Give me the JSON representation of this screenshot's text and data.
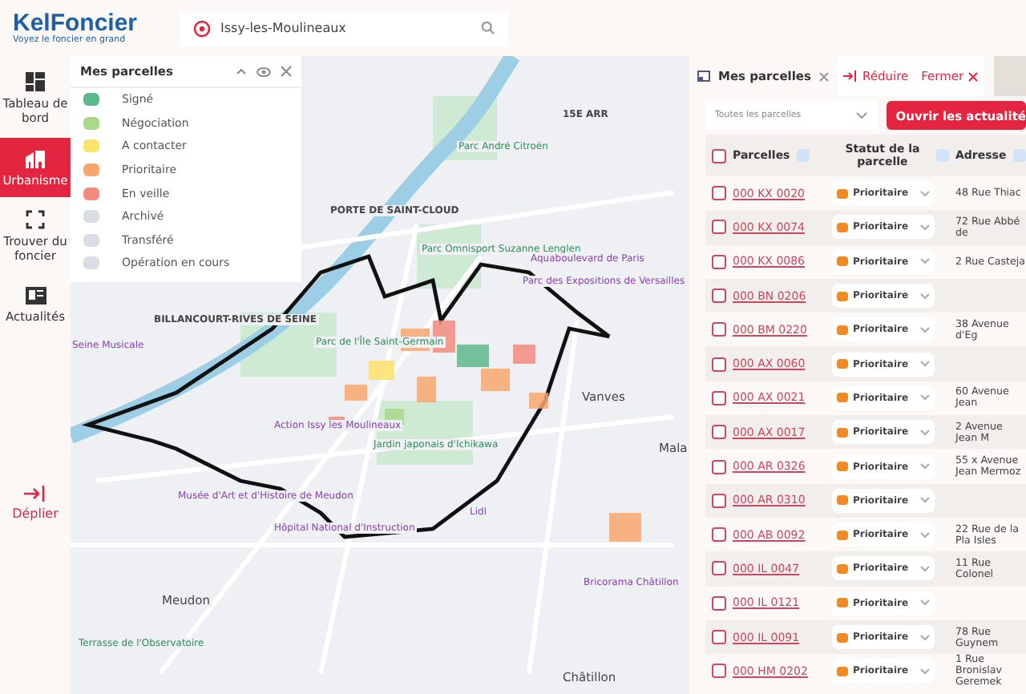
{
  "header": {
    "logo": "KelFoncier",
    "tagline": "Voyez le foncier en grand",
    "search": {
      "value": "Issy-les-Moulineaux"
    }
  },
  "sidebar": {
    "items": [
      {
        "label": "Tableau de bord",
        "selected": false
      },
      {
        "label": "Urbanisme",
        "selected": true
      },
      {
        "label": "Trouver du foncier",
        "selected": false
      },
      {
        "label": "Actualités",
        "selected": false
      }
    ],
    "expand": "Déplier"
  },
  "legend": {
    "title": "Mes parcelles",
    "items": [
      {
        "label": "Signé",
        "color": "#5cb98a"
      },
      {
        "label": "Négociation",
        "color": "#a8d98a"
      },
      {
        "label": "A contacter",
        "color": "#fde26a"
      },
      {
        "label": "Prioritaire",
        "color": "#f9a66c"
      },
      {
        "label": "En veille",
        "color": "#f28b7e"
      },
      {
        "label": "Archivé",
        "color": "#d9dde6"
      },
      {
        "label": "Transféré",
        "color": "#d9dde6"
      },
      {
        "label": "Opération en cours",
        "color": "#d9dde6"
      }
    ]
  },
  "map": {
    "labels": [
      {
        "text": "15E ARR",
        "kind": "district"
      },
      {
        "text": "Parc André Citroën",
        "kind": "park"
      },
      {
        "text": "PORTE DE SAINT-CLOUD",
        "kind": "district"
      },
      {
        "text": "Parc Omnisport Suzanne Lenglen",
        "kind": "park"
      },
      {
        "text": "Aquaboulevard de Paris",
        "kind": "poi"
      },
      {
        "text": "Parc des Expositions de Versailles",
        "kind": "poi"
      },
      {
        "text": "BILLANCOURT-RIVES DE SEINE",
        "kind": "district"
      },
      {
        "text": "Seine Musicale",
        "kind": "poi"
      },
      {
        "text": "Parc de l'Île Saint-Germain",
        "kind": "park"
      },
      {
        "text": "Action Issy les Moulineaux",
        "kind": "poi"
      },
      {
        "text": "Jardin japonais d'Ichikawa",
        "kind": "park"
      },
      {
        "text": "Vanves",
        "kind": "town"
      },
      {
        "text": "Musée d'Art et d'Histoire de Meudon",
        "kind": "poi"
      },
      {
        "text": "Hôpital National d'Instruction",
        "kind": "poi"
      },
      {
        "text": "Lidl",
        "kind": "poi"
      },
      {
        "text": "Meudon",
        "kind": "town"
      },
      {
        "text": "Mala",
        "kind": "town"
      },
      {
        "text": "Bricorama Châtillon",
        "kind": "poi"
      },
      {
        "text": "Terrasse de l'Observatoire",
        "kind": "park"
      },
      {
        "text": "Châtillon",
        "kind": "town"
      }
    ]
  },
  "panel": {
    "tab": {
      "label": "Mes parcelles",
      "selected": true
    },
    "reduce": "Réduire",
    "close": "Fermer",
    "filter": {
      "value": "Toutes les parcelles"
    },
    "news_button": "Ouvrir les actualité",
    "columns": [
      "Parcelles",
      "Statut de la parcelle",
      "Adresse"
    ],
    "select_all": {
      "checked": false
    },
    "rows": [
      {
        "parcel": "000 KX 0020",
        "status": "Prioritaire",
        "color": "#f08a24",
        "address": "48 Rue Thiac",
        "checked": false
      },
      {
        "parcel": "000 KX 0074",
        "status": "Prioritaire",
        "color": "#f08a24",
        "address": "72 Rue Abbé de",
        "checked": false
      },
      {
        "parcel": "000 KX 0086",
        "status": "Prioritaire",
        "color": "#f08a24",
        "address": "2 Rue Casteja",
        "checked": false
      },
      {
        "parcel": "000 BN 0206",
        "status": "Prioritaire",
        "color": "#f08a24",
        "checked": false
      },
      {
        "parcel": "000 BM 0220",
        "status": "Prioritaire",
        "color": "#f08a24",
        "address": "38 Avenue d'Eg",
        "checked": false
      },
      {
        "parcel": "000 AX 0060",
        "status": "Prioritaire",
        "color": "#f08a24",
        "checked": false
      },
      {
        "parcel": "000 AX 0021",
        "status": "Prioritaire",
        "color": "#f08a24",
        "address": "60 Avenue Jean",
        "checked": false
      },
      {
        "parcel": "000 AX 0017",
        "status": "Prioritaire",
        "color": "#f08a24",
        "address": "2 Avenue Jean M",
        "checked": false
      },
      {
        "parcel": "000 AR 0326",
        "status": "Prioritaire",
        "color": "#f08a24",
        "address": "55 x Avenue Jean Mermoz",
        "checked": false
      },
      {
        "parcel": "000 AR 0310",
        "status": "Prioritaire",
        "color": "#f08a24",
        "checked": false
      },
      {
        "parcel": "000 AB 0092",
        "status": "Prioritaire",
        "color": "#f08a24",
        "address": "22 Rue de la Pla Isles",
        "checked": false
      },
      {
        "parcel": "000 IL 0047",
        "status": "Prioritaire",
        "color": "#f08a24",
        "address": "11 Rue Colonel",
        "checked": false
      },
      {
        "parcel": "000 IL 0121",
        "status": "Prioritaire",
        "color": "#f08a24",
        "checked": false
      },
      {
        "parcel": "000 IL 0091",
        "status": "Prioritaire",
        "color": "#f08a24",
        "address": "78 Rue Guynem",
        "checked": false
      },
      {
        "parcel": "000 HM 0202",
        "status": "Prioritaire",
        "color": "#f08a24",
        "address": "1 Rue Bronislav Geremek",
        "checked": false
      }
    ]
  }
}
